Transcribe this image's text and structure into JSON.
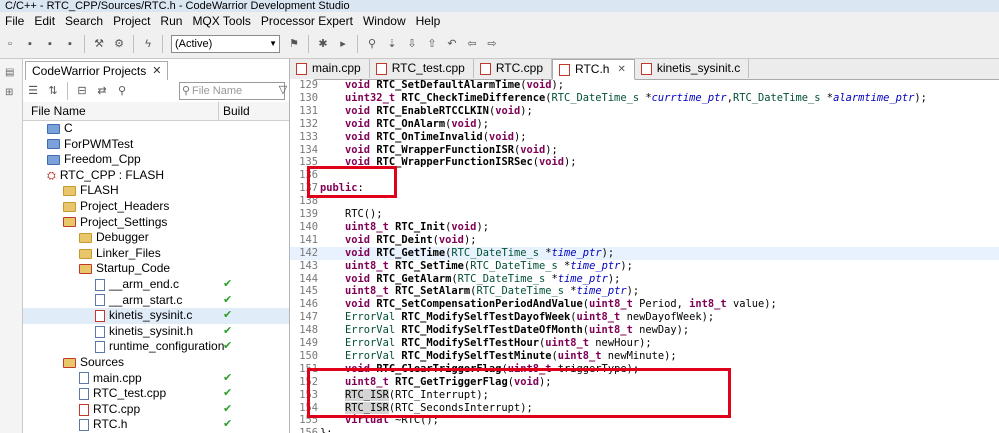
{
  "window": {
    "title": "C/C++ - RTC_CPP/Sources/RTC.h - CodeWarrior Development Studio"
  },
  "menu": [
    "File",
    "Edit",
    "Search",
    "Project",
    "Run",
    "MQX Tools",
    "Processor Expert",
    "Window",
    "Help"
  ],
  "toolbar": {
    "config": "(Active)"
  },
  "explorer": {
    "tab_label": "CodeWarrior Projects",
    "filter_placeholder": "File Name",
    "col_name": "File Name",
    "col_build": "Build",
    "rows": [
      {
        "label": "C",
        "indent": 1,
        "icon": "folder-blue",
        "check": false,
        "selected": false
      },
      {
        "label": "ForPWMTest",
        "indent": 1,
        "icon": "folder-blue",
        "check": false,
        "selected": false
      },
      {
        "label": "Freedom_Cpp",
        "indent": 1,
        "icon": "folder-blue",
        "check": false,
        "selected": false
      },
      {
        "label": "RTC_CPP  :  FLASH",
        "indent": 1,
        "icon": "project",
        "check": false,
        "selected": false
      },
      {
        "label": "FLASH",
        "indent": 2,
        "icon": "folder",
        "check": false,
        "selected": false
      },
      {
        "label": "Project_Headers",
        "indent": 2,
        "icon": "folder",
        "check": false,
        "selected": false
      },
      {
        "label": "Project_Settings",
        "indent": 2,
        "icon": "folder-red",
        "check": false,
        "selected": false
      },
      {
        "label": "Debugger",
        "indent": 3,
        "icon": "folder",
        "check": false,
        "selected": false
      },
      {
        "label": "Linker_Files",
        "indent": 3,
        "icon": "folder",
        "check": false,
        "selected": false
      },
      {
        "label": "Startup_Code",
        "indent": 3,
        "icon": "folder-red",
        "check": false,
        "selected": false
      },
      {
        "label": "__arm_end.c",
        "indent": 4,
        "icon": "file-c",
        "check": true,
        "selected": false
      },
      {
        "label": "__arm_start.c",
        "indent": 4,
        "icon": "file-c",
        "check": true,
        "selected": false
      },
      {
        "label": "kinetis_sysinit.c",
        "indent": 4,
        "icon": "file-cpp",
        "check": true,
        "selected": true
      },
      {
        "label": "kinetis_sysinit.h",
        "indent": 4,
        "icon": "file-h",
        "check": true,
        "selected": false
      },
      {
        "label": "runtime_configuration",
        "indent": 4,
        "icon": "file-h",
        "check": true,
        "selected": false
      },
      {
        "label": "Sources",
        "indent": 2,
        "icon": "folder-red",
        "check": false,
        "selected": false
      },
      {
        "label": "main.cpp",
        "indent": 3,
        "icon": "file-c",
        "check": true,
        "selected": false
      },
      {
        "label": "RTC_test.cpp",
        "indent": 3,
        "icon": "file-c",
        "check": true,
        "selected": false
      },
      {
        "label": "RTC.cpp",
        "indent": 3,
        "icon": "file-cpp",
        "check": true,
        "selected": false
      },
      {
        "label": "RTC.h",
        "indent": 3,
        "icon": "file-h",
        "check": true,
        "selected": false
      }
    ]
  },
  "editor": {
    "tabs": [
      {
        "label": "main.cpp",
        "active": false
      },
      {
        "label": "RTC_test.cpp",
        "active": false
      },
      {
        "label": "RTC.cpp",
        "active": false
      },
      {
        "label": "RTC.h",
        "active": true
      },
      {
        "label": "kinetis_sysinit.c",
        "active": false
      }
    ],
    "lines": [
      {
        "n": "129",
        "t": "    void RTC_SetDefaultAlarmTime(void);",
        "hl": false
      },
      {
        "n": "130",
        "t": "    uint32_t RTC_CheckTimeDifference(RTC_DateTime_s *currtime_ptr,RTC_DateTime_s *alarmtime_ptr);",
        "hl": false
      },
      {
        "n": "131",
        "t": "    void RTC_EnableRTCCLKIN(void);",
        "hl": false
      },
      {
        "n": "132",
        "t": "    void RTC_OnAlarm(void);",
        "hl": false
      },
      {
        "n": "133",
        "t": "    void RTC_OnTimeInvalid(void);",
        "hl": false
      },
      {
        "n": "134",
        "t": "    void RTC_WrapperFunctionISR(void);",
        "hl": false
      },
      {
        "n": "135",
        "t": "    void RTC_WrapperFunctionISRSec(void);",
        "hl": false
      },
      {
        "n": "136",
        "t": "",
        "hl": false
      },
      {
        "n": "137",
        "t": "public:",
        "hl": false
      },
      {
        "n": "138",
        "t": "",
        "hl": false
      },
      {
        "n": "139",
        "t": "    RTC();",
        "hl": false
      },
      {
        "n": "140",
        "t": "    uint8_t RTC_Init(void);",
        "hl": false
      },
      {
        "n": "141",
        "t": "    void RTC_Deint(void);",
        "hl": false
      },
      {
        "n": "142",
        "t": "    void RTC_GetTime(RTC_DateTime_s *time_ptr);",
        "hl": true
      },
      {
        "n": "143",
        "t": "    uint8_t RTC_SetTime(RTC_DateTime_s *time_ptr);",
        "hl": false
      },
      {
        "n": "144",
        "t": "    void RTC_GetAlarm(RTC_DateTime_s *time_ptr);",
        "hl": false
      },
      {
        "n": "145",
        "t": "    uint8_t RTC_SetAlarm(RTC_DateTime_s *time_ptr);",
        "hl": false
      },
      {
        "n": "146",
        "t": "    void RTC_SetCompensationPeriodAndValue(uint8_t Period, int8_t value);",
        "hl": false
      },
      {
        "n": "147",
        "t": "    ErrorVal RTC_ModifySelfTestDayofWeek(uint8_t newDayofWeek);",
        "hl": false
      },
      {
        "n": "148",
        "t": "    ErrorVal RTC_ModifySelfTestDateOfMonth(uint8_t newDay);",
        "hl": false
      },
      {
        "n": "149",
        "t": "    ErrorVal RTC_ModifySelfTestHour(uint8_t newHour);",
        "hl": false
      },
      {
        "n": "150",
        "t": "    ErrorVal RTC_ModifySelfTestMinute(uint8_t newMinute);",
        "hl": false
      },
      {
        "n": "151",
        "t": "    void RTC_ClearTriggerFlag(uint8_t triggerType);",
        "hl": false
      },
      {
        "n": "152",
        "t": "    uint8_t RTC_GetTriggerFlag(void);",
        "hl": false
      },
      {
        "n": "153",
        "t": "    RTC_ISR(RTC_Interrupt);",
        "hl": false
      },
      {
        "n": "154",
        "t": "    RTC_ISR(RTC_SecondsInterrupt);",
        "hl": false
      },
      {
        "n": "155",
        "t": "    virtual ~RTC();",
        "hl": false
      },
      {
        "n": "156",
        "t": "};",
        "hl": false
      }
    ]
  }
}
